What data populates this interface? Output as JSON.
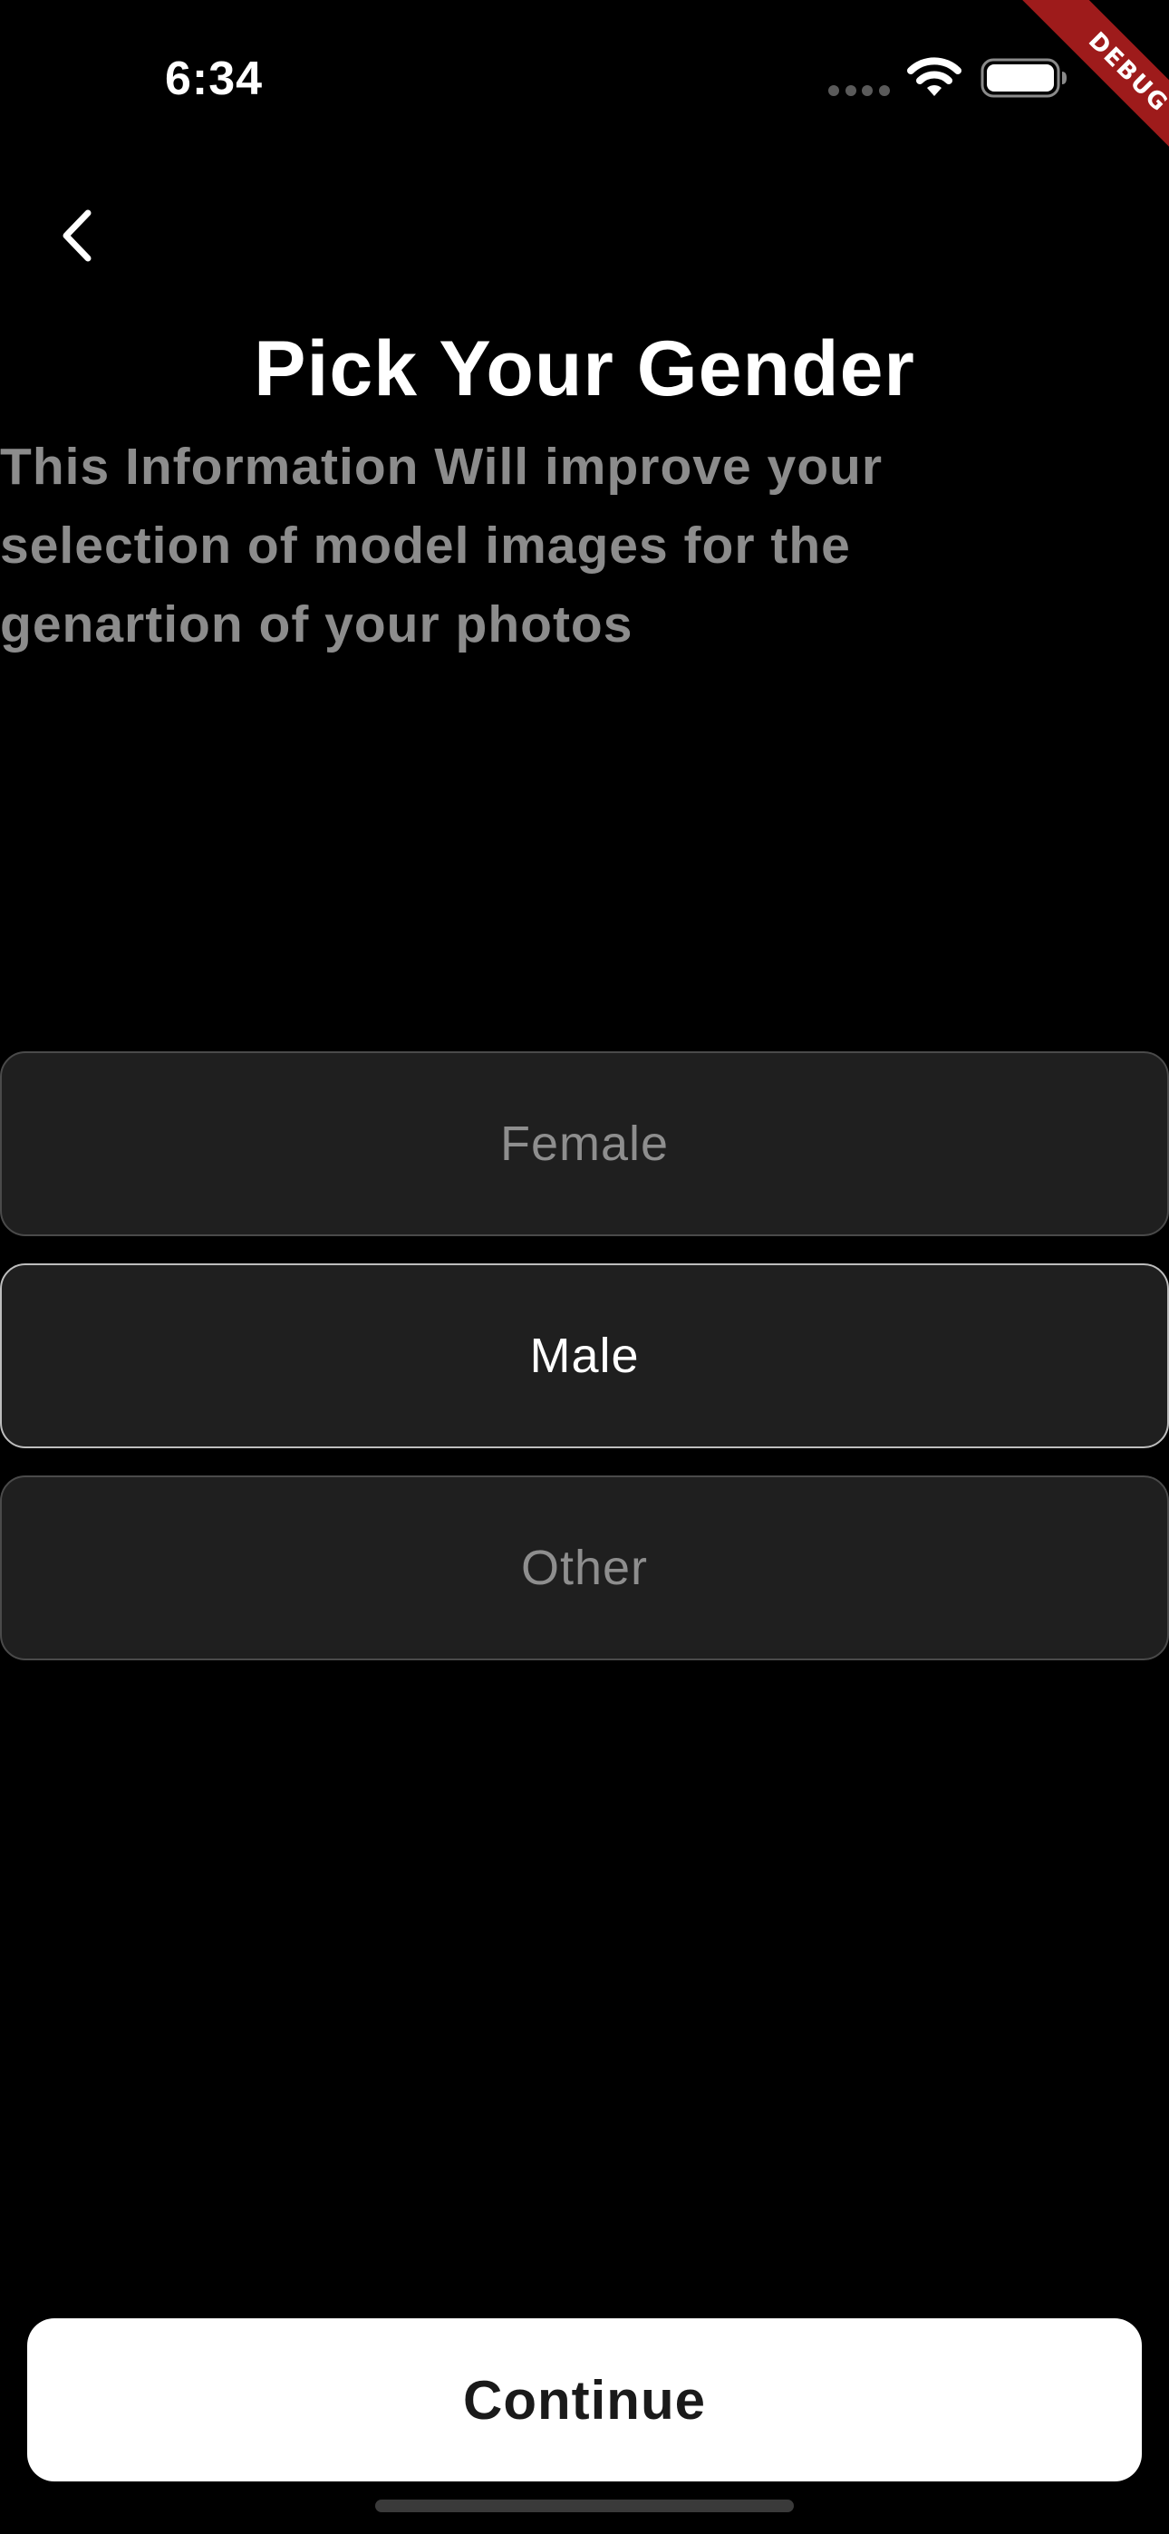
{
  "status_bar": {
    "time": "6:34",
    "icons": [
      "signal-dots-icon",
      "wifi-icon",
      "battery-icon"
    ]
  },
  "debug_banner": {
    "label": "DEBUG",
    "color": "#9e1b1b"
  },
  "header": {
    "back_icon": "chevron-left-icon",
    "title": "Pick Your Gender",
    "subtitle": "This Information Will improve your selection of model images for the genartion of your photos"
  },
  "gender_options": [
    {
      "label": "Female",
      "selected": false
    },
    {
      "label": "Male",
      "selected": true
    },
    {
      "label": "Other",
      "selected": false
    }
  ],
  "footer": {
    "continue_label": "Continue"
  },
  "colors": {
    "background": "#000000",
    "option_background": "#1f1f1f",
    "option_border": "#4a4a4a",
    "option_selected_border": "#bdbdbd",
    "muted_text": "#8c8c8c",
    "button_background": "#ffffff",
    "button_text": "#1a1a1a"
  }
}
